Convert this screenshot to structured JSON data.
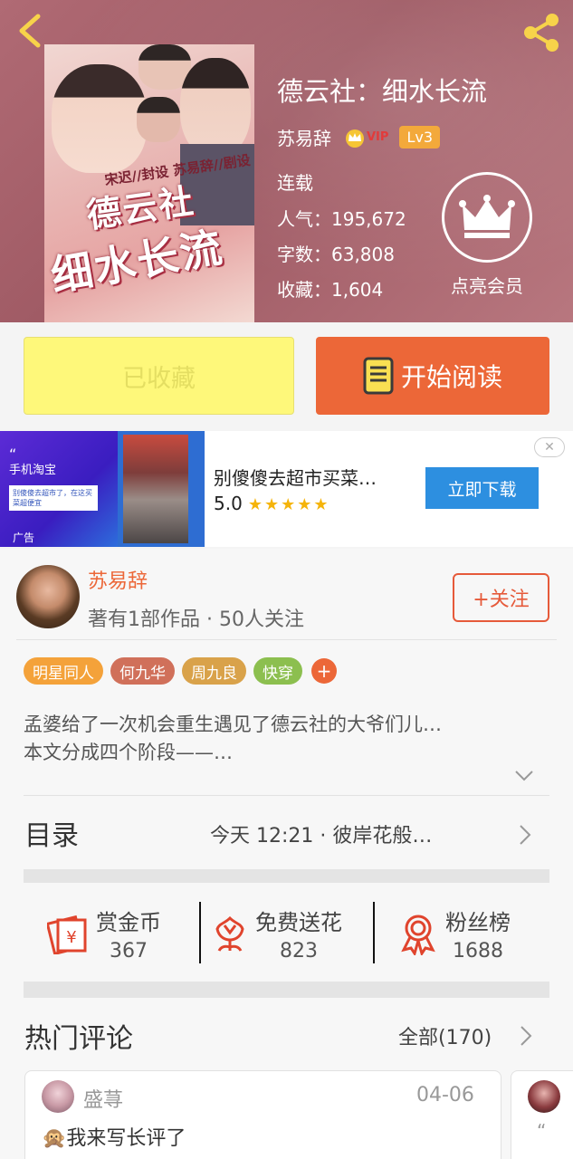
{
  "book": {
    "title": "德云社：细水长流",
    "author": "苏易辞",
    "vip_badge": "VIP",
    "level_badge": "Lv3",
    "status": "连载",
    "popularity": "人气：195,672",
    "word_count": "字数：63,808",
    "favorites": "收藏：1,604",
    "member_label": "点亮会员",
    "cover": {
      "credits": "宋迟//封设  苏易辞//剧设",
      "title_line1": "德云社",
      "title_line2": "细水长流"
    }
  },
  "actions": {
    "favorited_label": "已收藏",
    "read_label": "开始阅读"
  },
  "ad": {
    "brand": "手机淘宝",
    "card_text": "别傻傻去超市了，在这买菜超便宜",
    "corner_label": "广告",
    "title": "别傻傻去超市买菜…",
    "rating": "5.0",
    "stars": "★★★★★",
    "download_label": "立即下载",
    "close_icon": "close-icon"
  },
  "author_card": {
    "name": "苏易辞",
    "subtitle": "著有1部作品 · 50人关注",
    "follow_label": "+关注"
  },
  "tags": [
    {
      "label": "明星同人",
      "color": "#f4a23a"
    },
    {
      "label": "何九华",
      "color": "#d0705a"
    },
    {
      "label": "周九良",
      "color": "#d9a24a"
    },
    {
      "label": "快穿",
      "color": "#8cbf4f"
    }
  ],
  "tag_plus": "+",
  "description": {
    "line1": "孟婆给了一次机会重生遇见了德云社的大爷们儿…",
    "line2": "本文分成四个阶段——…"
  },
  "toc": {
    "label": "目录",
    "latest": "今天 12:21 · 彼岸花般…"
  },
  "gifts": [
    {
      "name": "赏金币",
      "count": "367",
      "icon": "coin-envelope-icon"
    },
    {
      "name": "免费送花",
      "count": "823",
      "icon": "flower-icon"
    },
    {
      "name": "粉丝榜",
      "count": "1688",
      "icon": "medal-icon"
    }
  ],
  "comments_section": {
    "label": "热门评论",
    "all_label": "全部(170)"
  },
  "comments": [
    {
      "user": "盛荨",
      "date": "04-06",
      "text": "🙊我来写长评了"
    }
  ],
  "colors": {
    "accent": "#ec6738",
    "header_bg": "#a8626c",
    "fav_button": "#fef87a",
    "download_blue": "#2d8fe0"
  }
}
